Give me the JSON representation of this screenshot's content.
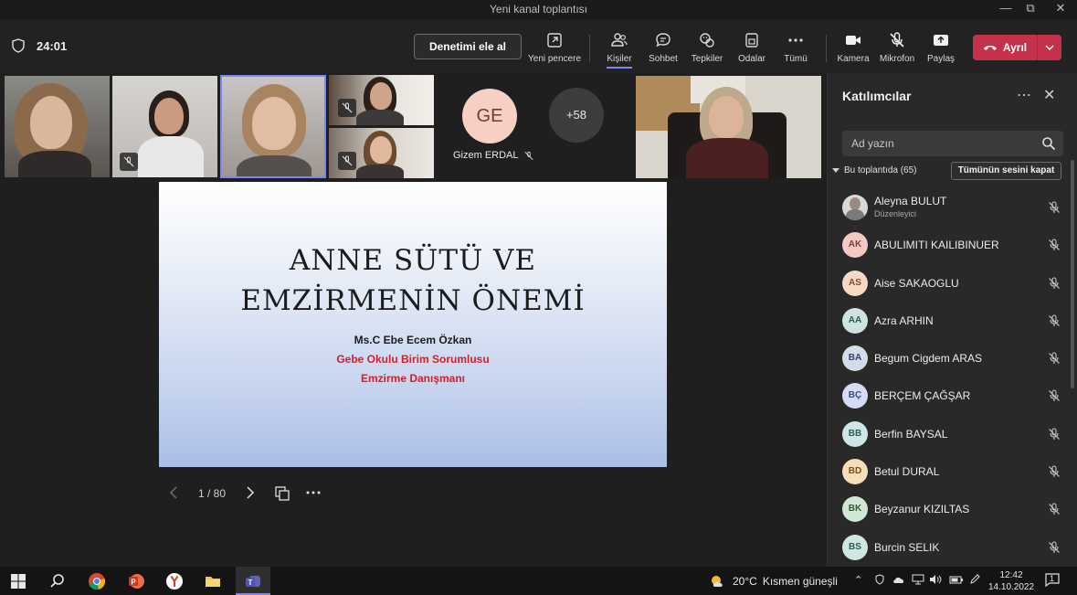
{
  "window": {
    "title": "Yeni kanal toplantısı"
  },
  "toolbar": {
    "timer": "24:01",
    "take_control": "Denetimi ele al",
    "tools": [
      {
        "label": "Yeni pencere",
        "icon": "new-window-icon"
      },
      {
        "label": "Kişiler",
        "icon": "people-icon"
      },
      {
        "label": "Sohbet",
        "icon": "chat-icon"
      },
      {
        "label": "Tepkiler",
        "icon": "reactions-icon"
      },
      {
        "label": "Odalar",
        "icon": "rooms-icon"
      },
      {
        "label": "Tümü",
        "icon": "more-icon"
      },
      {
        "label": "Kamera",
        "icon": "camera-icon"
      },
      {
        "label": "Mikrofon",
        "icon": "mic-off-icon"
      },
      {
        "label": "Paylaş",
        "icon": "share-icon"
      }
    ],
    "leave": "Ayrıl"
  },
  "video": {
    "avatar_initials": "GE",
    "avatar_name": "Gizem ERDAL",
    "overflow_count": "+58"
  },
  "slide": {
    "title_line1": "ANNE SÜTÜ VE",
    "title_line2": "EMZİRMENİN ÖNEMİ",
    "author": "Ms.C Ebe Ecem Özkan",
    "role1": "Gebe Okulu Birim Sorumlusu",
    "role2": "Emzirme Danışmanı",
    "page": "1 / 80"
  },
  "participants": {
    "title": "Katılımcılar",
    "search_placeholder": "Ad yazın",
    "section": "Bu toplantıda (65)",
    "mute_all": "Tümünün sesini kapat",
    "list": [
      {
        "initials": "",
        "name": "Aleyna BULUT",
        "role": "Düzenleyici",
        "bg": "#d9d9d9",
        "fg": "#333333"
      },
      {
        "initials": "AK",
        "name": "ABULIMITI KAILIBINUER",
        "role": "",
        "bg": "#f4c9c4",
        "fg": "#8a3a32"
      },
      {
        "initials": "AS",
        "name": "Aise SAKAOGLU",
        "role": "",
        "bg": "#f7d8c4",
        "fg": "#8a4a28"
      },
      {
        "initials": "AA",
        "name": "Azra ARHIN",
        "role": "",
        "bg": "#cfe3e0",
        "fg": "#2e5a55"
      },
      {
        "initials": "BA",
        "name": "Begum Cigdem ARAS",
        "role": "",
        "bg": "#d3dcea",
        "fg": "#34476a"
      },
      {
        "initials": "BÇ",
        "name": "BERÇEM ÇAĞŞAR",
        "role": "",
        "bg": "#d6dcf4",
        "fg": "#3a4a8a"
      },
      {
        "initials": "BB",
        "name": "Berfin BAYSAL",
        "role": "",
        "bg": "#cfe6e6",
        "fg": "#2c5c5c"
      },
      {
        "initials": "BD",
        "name": "Betul DURAL",
        "role": "",
        "bg": "#f6dfb8",
        "fg": "#7a5220"
      },
      {
        "initials": "BK",
        "name": "Beyzanur KIZILTAS",
        "role": "",
        "bg": "#d2e6d4",
        "fg": "#2f5a34"
      },
      {
        "initials": "BS",
        "name": "Burcin SELIK",
        "role": "",
        "bg": "#cfe6e2",
        "fg": "#2c5c55"
      }
    ]
  },
  "taskbar": {
    "weather_temp": "20°C",
    "weather_text": "Kısmen güneşli",
    "time": "12:42",
    "date": "14.10.2022",
    "notifications": "1"
  },
  "colors": {
    "accent": "#7f85f5",
    "leave": "#c4314b",
    "slide_red": "#d0202a"
  }
}
